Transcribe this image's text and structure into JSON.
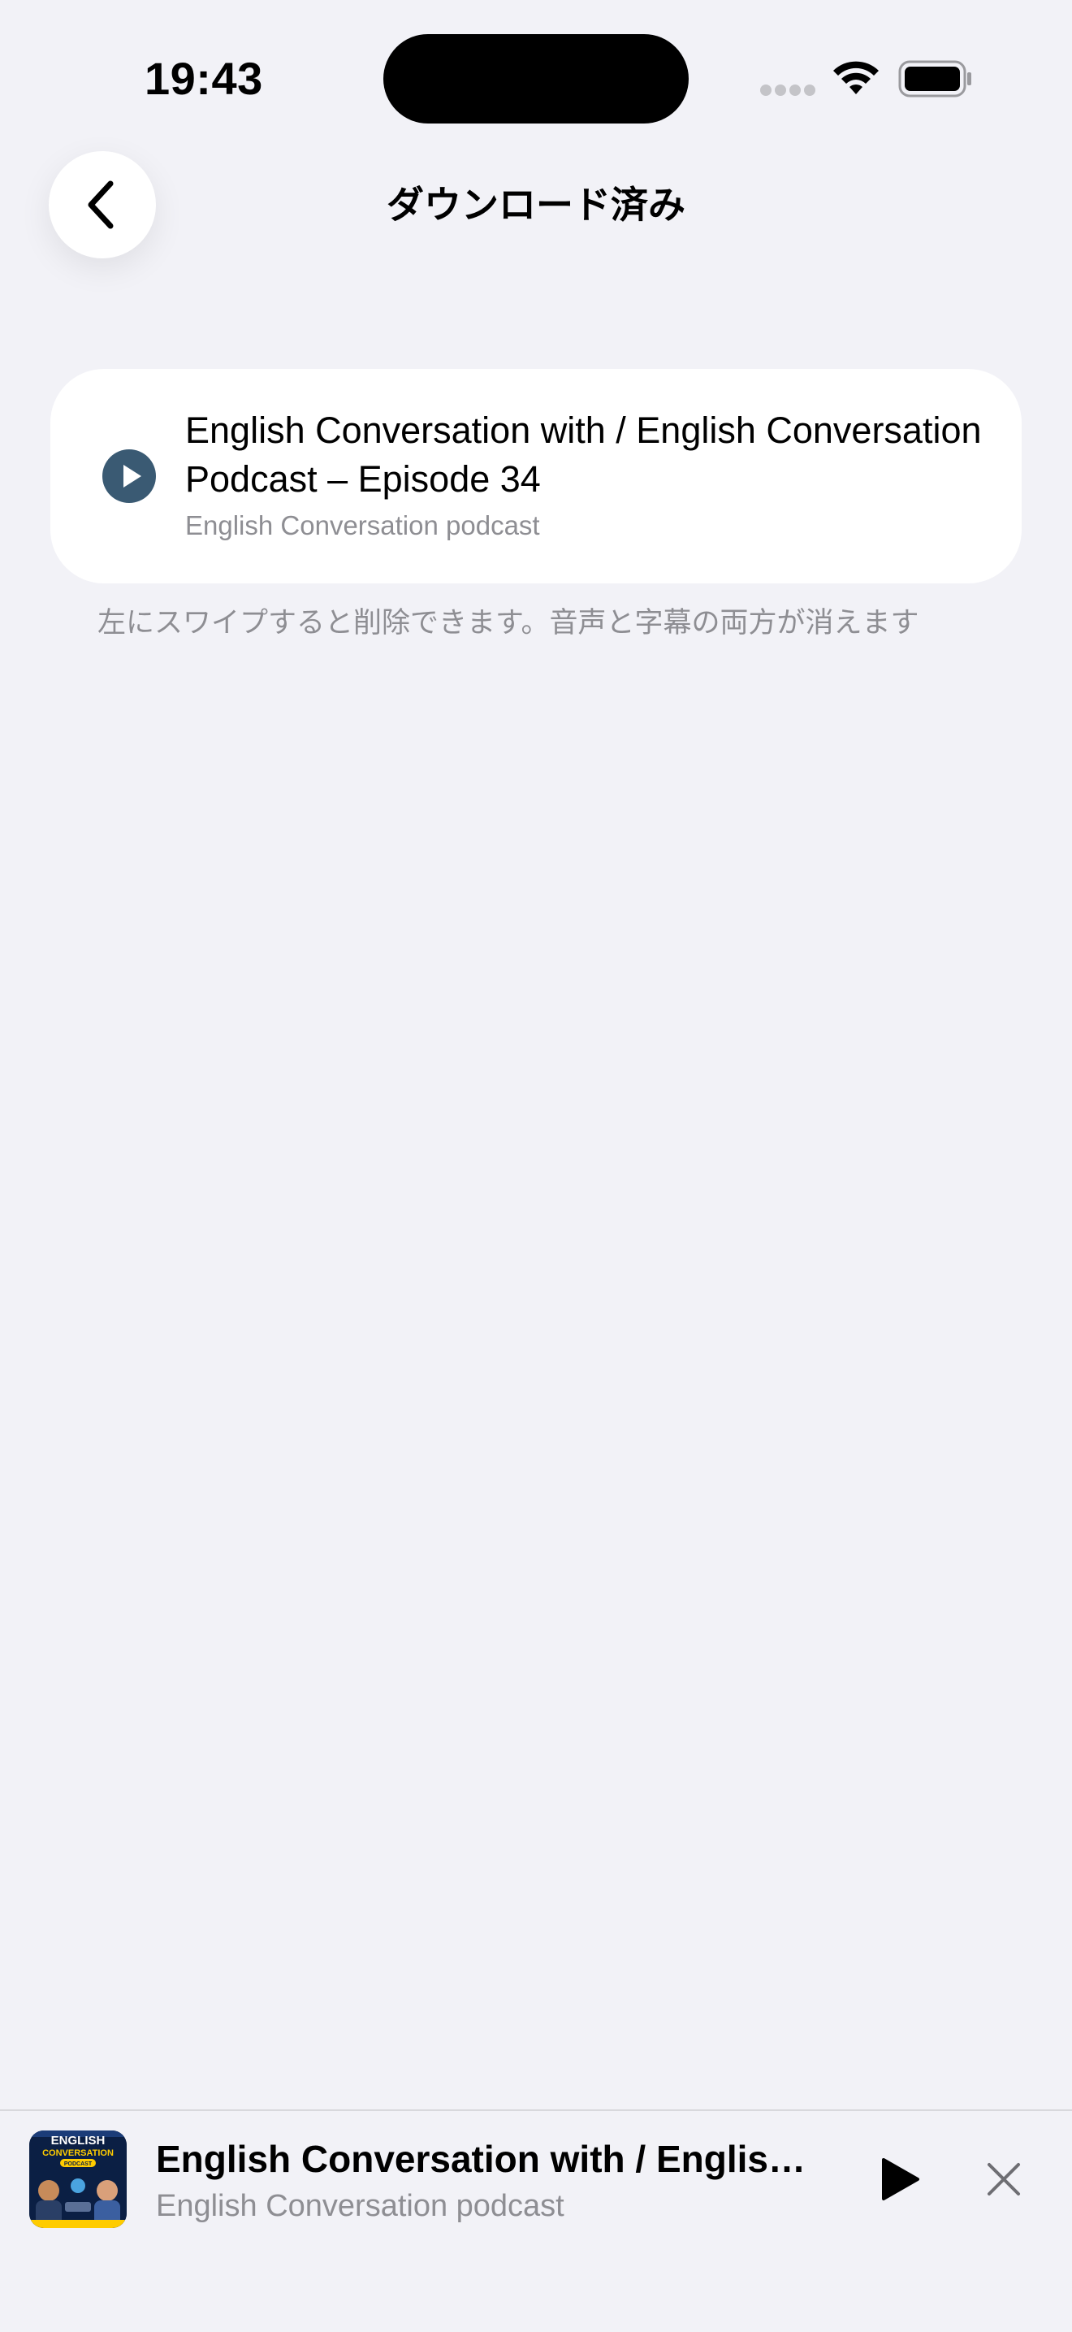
{
  "status_bar": {
    "time": "19:43"
  },
  "nav": {
    "title": "ダウンロード済み",
    "back_icon": "chevron-left-icon"
  },
  "downloads": [
    {
      "title": "English Conversation with / English Conversation Podcast – Episode 34",
      "subtitle": "English Conversation podcast",
      "icon": "play-circle-icon"
    }
  ],
  "hint": "左にスワイプすると削除できます。音声と字幕の両方が消えます",
  "mini_player": {
    "title": "English Conversation with / English...",
    "subtitle": "English Conversation podcast",
    "artwork": {
      "line1": "ENGLISH",
      "line2": "CONVERSATION",
      "line3": "PODCAST"
    },
    "play_icon": "play-icon",
    "close_icon": "close-icon"
  },
  "colors": {
    "background": "#f2f2f7",
    "card": "#ffffff",
    "play_accent": "#3a5a73",
    "secondary_text": "#8e8e93"
  }
}
